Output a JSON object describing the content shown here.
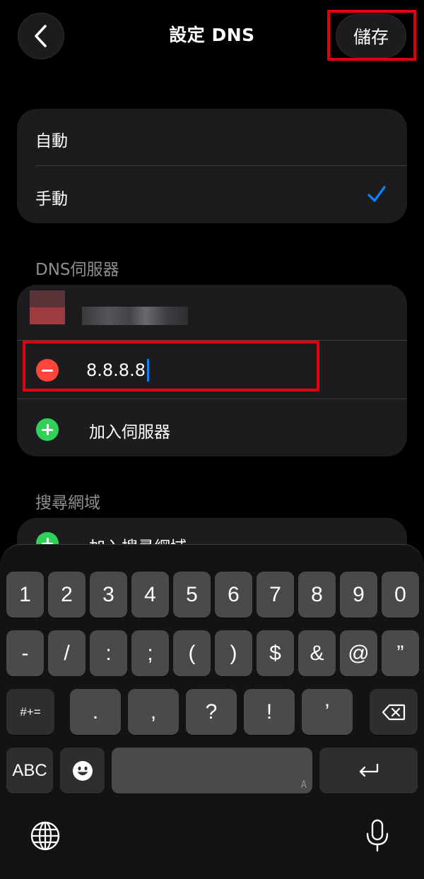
{
  "header": {
    "title": "設定 DNS",
    "save_label": "儲存"
  },
  "dns_mode": {
    "options": [
      {
        "label": "自動",
        "selected": false
      },
      {
        "label": "手動",
        "selected": true
      }
    ]
  },
  "dns_servers": {
    "section_title": "DNS伺服器",
    "editing_value": "8.8.8.8",
    "add_label": "加入伺服器"
  },
  "search_domains": {
    "section_title": "搜尋網域",
    "add_label": "加入搜尋網域"
  },
  "keyboard": {
    "row1": [
      "1",
      "2",
      "3",
      "4",
      "5",
      "6",
      "7",
      "8",
      "9",
      "0"
    ],
    "row2": [
      "-",
      "/",
      ":",
      ";",
      "(",
      ")",
      "$",
      "&",
      "@",
      "”"
    ],
    "row3_left": "#+=",
    "row3": [
      ".",
      ",",
      "?",
      "!",
      "’"
    ],
    "abc_label": "ABC",
    "space_hint": "A"
  },
  "colors": {
    "accent": "#0a84ff",
    "remove": "#ff453a",
    "add": "#30d158",
    "highlight": "#e0000e"
  }
}
